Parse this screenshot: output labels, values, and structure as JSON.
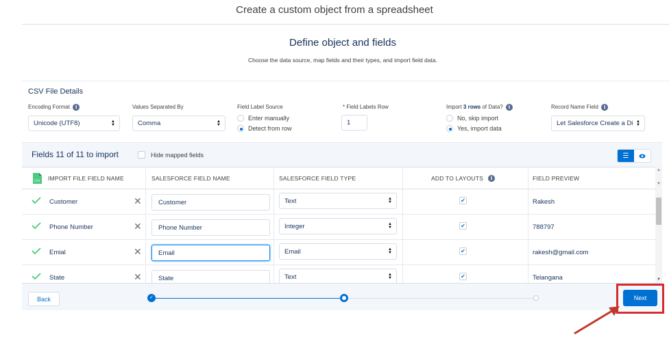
{
  "wizard": {
    "title": "Create a custom object from a spreadsheet",
    "step_heading": "Define object and fields",
    "step_subtitle": "Choose the data source, map fields and their types, and import field data."
  },
  "csv": {
    "section_title": "CSV File Details",
    "encoding_label": "Encoding Format",
    "encoding_value": "Unicode (UTF8)",
    "separator_label": "Values Separated By",
    "separator_value": "Comma",
    "label_source_label": "Field Label Source",
    "label_source_options": [
      "Enter manually",
      "Detect from row"
    ],
    "label_source_selected": "Detect from row",
    "labels_row_label": "* Field Labels Row",
    "labels_row_value": "1",
    "import_label_prefix": "Import ",
    "import_label_bold": "3 rows",
    "import_label_suffix": " of Data?",
    "import_options": [
      "No, skip import",
      "Yes, import data"
    ],
    "import_selected": "Yes, import data",
    "record_name_label": "Record Name Field",
    "record_name_value": "Let Salesforce Create a Di"
  },
  "fields_bar": {
    "count_text": "Fields 11 of 11 to import",
    "hide_mapped_label": "Hide mapped fields"
  },
  "table": {
    "headers": {
      "import_name": "IMPORT FILE FIELD NAME",
      "sf_name": "SALESFORCE FIELD NAME",
      "sf_type": "SALESFORCE FIELD TYPE",
      "add_layouts": "ADD TO LAYOUTS",
      "preview": "FIELD PREVIEW"
    },
    "rows": [
      {
        "import_name": "Customer",
        "sf_name": "Customer",
        "sf_type": "Text",
        "add_to_layouts": true,
        "preview": "Rakesh"
      },
      {
        "import_name": "Phone Number",
        "sf_name": "Phone Number",
        "sf_type": "Integer",
        "add_to_layouts": true,
        "preview": "788797"
      },
      {
        "import_name": "Emial",
        "sf_name": "Email",
        "sf_type": "Email",
        "add_to_layouts": true,
        "preview": "rakesh@gmail.com"
      },
      {
        "import_name": "State",
        "sf_name": "State",
        "sf_type": "Text",
        "add_to_layouts": true,
        "preview": "Telangana"
      }
    ]
  },
  "footer": {
    "back_label": "Back",
    "next_label": "Next"
  },
  "colors": {
    "brand": "#0070d2",
    "success": "#4bca81",
    "highlight": "#d52b2b"
  }
}
